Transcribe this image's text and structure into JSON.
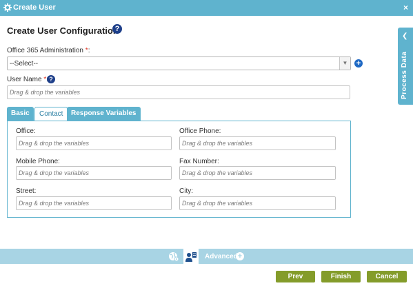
{
  "window": {
    "title": "Create User",
    "close_glyph": "×",
    "icon": "gear-icon"
  },
  "heading": {
    "title": "Create User Configuration",
    "help_glyph": "?"
  },
  "office365": {
    "label": "Office 365 Administration",
    "required_marker": "*",
    "suffix": ":",
    "value": "--Select--",
    "add_glyph": "+"
  },
  "username": {
    "label": "User Name",
    "required_marker": "*",
    "suffix": ":",
    "placeholder": "Drag & drop the variables",
    "help_glyph": "?"
  },
  "tabs": [
    {
      "label": "Basic",
      "active": false
    },
    {
      "label": "Contact",
      "active": true
    },
    {
      "label": "Response Variables",
      "active": false
    }
  ],
  "contact": {
    "fields": [
      {
        "label": "Office:",
        "placeholder": "Drag & drop the variables"
      },
      {
        "label": "Office Phone:",
        "placeholder": "Drag & drop the variables"
      },
      {
        "label": "Mobile Phone:",
        "placeholder": "Drag & drop the variables"
      },
      {
        "label": "Fax Number:",
        "placeholder": "Drag & drop the variables"
      },
      {
        "label": "Street:",
        "placeholder": "Drag & drop the variables"
      },
      {
        "label": "City:",
        "placeholder": "Drag & drop the variables"
      }
    ]
  },
  "side_panel": {
    "label": "Process Data",
    "chevron": "❮"
  },
  "bottom_bar": {
    "advanced_label": "Advanced",
    "plus_glyph": "+"
  },
  "buttons": {
    "prev": "Prev",
    "finish": "Finish",
    "cancel": "Cancel"
  },
  "colors": {
    "accent": "#5fb3ce",
    "bottom_bar": "#a8d4e4",
    "button": "#849c2a",
    "required": "#e0301e",
    "help": "#1e3f8a"
  }
}
